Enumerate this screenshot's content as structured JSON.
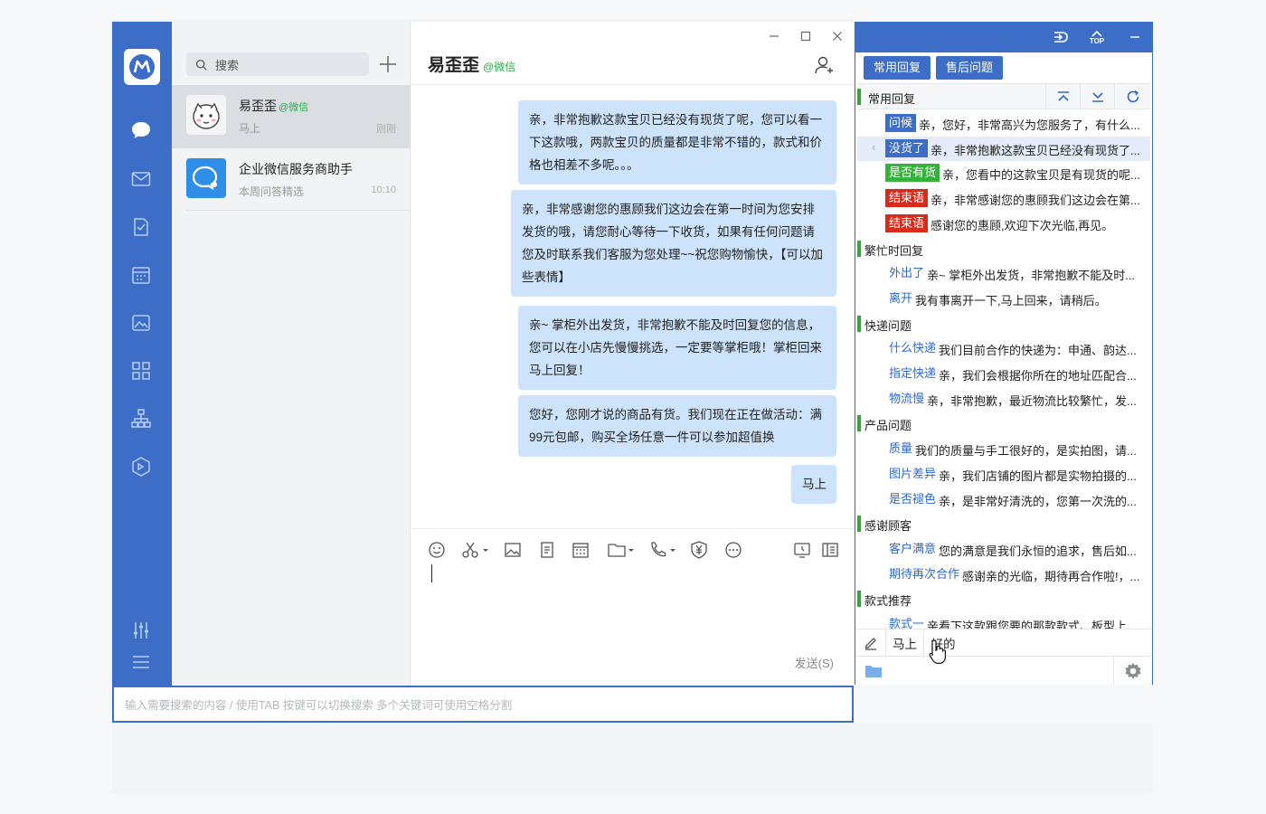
{
  "sessions_panel": {
    "search_placeholder": "搜索",
    "items": [
      {
        "name": "易歪歪",
        "source": "@微信",
        "preview": "马上",
        "time": "刚刚"
      },
      {
        "name": "企业微信服务商助手",
        "preview": "本周问答精选",
        "time": "10:10"
      }
    ]
  },
  "chat": {
    "title": "易歪歪",
    "source": "@微信",
    "messages": [
      "亲，非常抱歉这款宝贝已经没有现货了呢，您可以看一下这款哦，两款宝贝的质量都是非常不错的，款式和价格也相差不多呢。。。",
      "亲，非常感谢您的惠顾我们这边会在第一时间为您安排发货的哦，请您耐心等待一下收货，如果有任何问题请您及时联系我们客服为您处理~~祝您购物愉快，【可以加些表情】",
      "亲~ 掌柜外出发货，非常抱歉不能及时回复您的信息，您可以在小店先慢慢挑选，一定要等掌柜哦！掌柜回来马上回复！",
      "您好，您刚才说的商品有货。我们现在正在做活动：满99元包邮，购买全场任意一件可以参加超值换",
      "马上"
    ],
    "send_label": "发送(S)"
  },
  "bottom_search": {
    "placeholder": "输入需要搜索的内容 / 使用TAB 按键可以切换搜索 多个关键词可使用空格分割"
  },
  "quick_reply": {
    "top_icons": [
      "exit-icon",
      "top-icon",
      "minimize-icon"
    ],
    "top_label": "TOP",
    "tabs": [
      "常用回复",
      "售后问题"
    ],
    "header_label": "常用回复",
    "items": [
      {
        "type": "reply",
        "tag": "问候",
        "style": "blue",
        "text": "亲，您好，非常高兴为您服务了，有什么..."
      },
      {
        "type": "reply",
        "tag": "没货了",
        "style": "blue",
        "text": "亲，非常抱歉这款宝贝已经没有现货了...",
        "selected": true
      },
      {
        "type": "reply",
        "tag": "是否有货",
        "style": "green",
        "text": "亲，您看中的这款宝贝是有现货的呢..."
      },
      {
        "type": "reply",
        "tag": "结束语",
        "style": "red",
        "text": "亲，非常感谢您的惠顾我们这边会在第..."
      },
      {
        "type": "reply",
        "tag": "结束语",
        "style": "red",
        "text": "感谢您的惠顾,欢迎下次光临,再见。"
      },
      {
        "type": "category",
        "label": "繁忙时回复"
      },
      {
        "type": "reply",
        "tag": "外出了",
        "style": "link",
        "text": "亲~ 掌柜外出发货，非常抱歉不能及时..."
      },
      {
        "type": "reply",
        "tag": "离开",
        "style": "link",
        "text": "我有事离开一下,马上回来，请稍后。"
      },
      {
        "type": "category",
        "label": "快递问题"
      },
      {
        "type": "reply",
        "tag": "什么快递",
        "style": "link",
        "text": "我们目前合作的快递为：申通、韵达..."
      },
      {
        "type": "reply",
        "tag": "指定快递",
        "style": "link",
        "text": "亲，我们会根据你所在的地址匹配合..."
      },
      {
        "type": "reply",
        "tag": "物流慢",
        "style": "link",
        "text": "亲，非常抱歉，最近物流比较繁忙，发..."
      },
      {
        "type": "category",
        "label": "产品问题"
      },
      {
        "type": "reply",
        "tag": "质量",
        "style": "link",
        "text": "我们的质量与手工很好的，是实拍图，请..."
      },
      {
        "type": "reply",
        "tag": "图片差异",
        "style": "link",
        "text": "亲，我们店铺的图片都是实物拍摄的..."
      },
      {
        "type": "reply",
        "tag": "是否褪色",
        "style": "link",
        "text": "亲，是非常好清洗的，您第一次洗的..."
      },
      {
        "type": "category",
        "label": "感谢顾客"
      },
      {
        "type": "reply",
        "tag": "客户满意",
        "style": "link",
        "text": "您的满意是我们永恒的追求，售后如..."
      },
      {
        "type": "reply",
        "tag": "期待再次合作",
        "style": "link",
        "text": "感谢亲的光临，期待再合作啦!，..."
      },
      {
        "type": "category",
        "label": "款式推荐"
      },
      {
        "type": "reply",
        "tag": "款式一",
        "style": "link",
        "text": "亲看下这款跟您要的那款款式、板型上..."
      }
    ],
    "input_chips": [
      "马上",
      "好的"
    ]
  },
  "colors": {
    "brand": "#3d6ec7",
    "bubble": "#cde3fb",
    "green": "#34b23a",
    "red": "#d92a1c",
    "link": "#3068c8"
  }
}
